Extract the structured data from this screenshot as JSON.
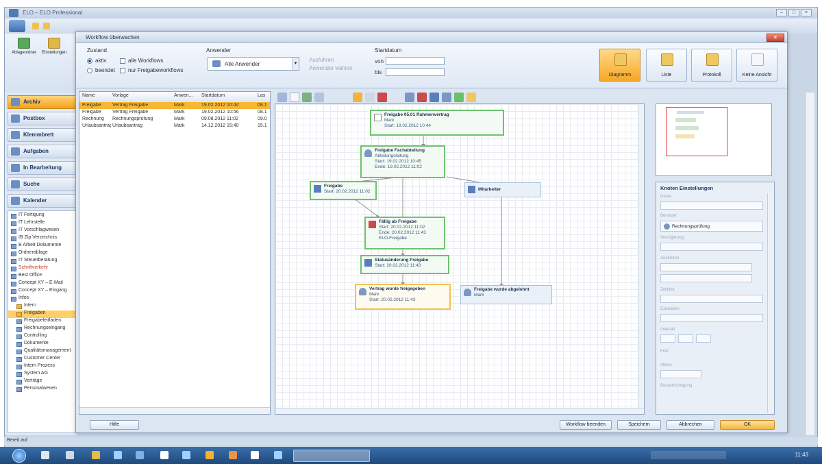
{
  "app": {
    "title": "ELO – ELO Professional",
    "minimize": "–",
    "maximize": "□",
    "close": "×"
  },
  "ribbon": {
    "button1": "Ablageordner",
    "button2": "Einstellungen"
  },
  "sidebar": {
    "items": [
      {
        "label": "Archiv",
        "active": true
      },
      {
        "label": "Postbox"
      },
      {
        "label": "Klemmbrett"
      },
      {
        "label": "Aufgaben"
      },
      {
        "label": "In Bearbeitung"
      },
      {
        "label": "Suche"
      },
      {
        "label": "Kalender"
      }
    ],
    "tree": [
      {
        "label": "IT Fertigung",
        "indent": 0
      },
      {
        "label": "IT Lehrstelle",
        "indent": 0
      },
      {
        "label": "IT Vorschlagwesen",
        "indent": 0
      },
      {
        "label": "IB Zip Verzeichnis",
        "indent": 0
      },
      {
        "label": "B Arbeit Dokumente",
        "indent": 0
      },
      {
        "label": "Ordnerablage",
        "indent": 0
      },
      {
        "label": "IT Steuerberatung",
        "indent": 0
      },
      {
        "label": "Schriftverkehr",
        "indent": 0
      },
      {
        "label": "Best Office",
        "indent": 0
      },
      {
        "label": "Concept XY – E-Mail",
        "indent": 0
      },
      {
        "label": "Concept XY – Eingang",
        "indent": 0
      },
      {
        "label": "Infos",
        "indent": 0
      },
      {
        "label": "Intern",
        "indent": 1
      },
      {
        "label": "Freigaben",
        "indent": 1,
        "selected": true
      },
      {
        "label": "Freigabeleitfaden",
        "indent": 1
      },
      {
        "label": "Rechnungseingang",
        "indent": 1
      },
      {
        "label": "Controlling",
        "indent": 1
      },
      {
        "label": "Dokumente",
        "indent": 1
      },
      {
        "label": "Qualitätsmanagement",
        "indent": 1
      },
      {
        "label": "Customer Center",
        "indent": 1
      },
      {
        "label": "Intern Prozess",
        "indent": 1
      },
      {
        "label": "System AG",
        "indent": 1
      },
      {
        "label": "Verträge",
        "indent": 1
      },
      {
        "label": "Personalwesen",
        "indent": 1
      }
    ]
  },
  "dialog": {
    "title": "Workflow überwachen",
    "close": "×",
    "filter": {
      "section1": "Zustand",
      "radio1": "aktiv",
      "radio2": "beendet",
      "check1": "alle Workflows",
      "check2": "nur Freigabeworkflows",
      "section2": "Anwender",
      "user_value": "Alle Anwender",
      "link1": "Ausführen",
      "link2": "Anwender wählen",
      "section3": "Startdatum",
      "from_label": "von",
      "to_label": "bis"
    },
    "views": [
      {
        "label": "Diagramm",
        "active": true
      },
      {
        "label": "Liste"
      },
      {
        "label": "Protokoll"
      },
      {
        "label": "Keine Ansicht"
      }
    ],
    "list": {
      "columns": [
        "Name",
        "Vorlage",
        "Anwen...",
        "Startdatum",
        "Las"
      ],
      "rows": [
        {
          "name": "Freigabe",
          "template": "Vertrag Freigabe",
          "user": "Mark",
          "date": "19.02.2012 10:44",
          "last": "08.1",
          "selected": true
        },
        {
          "name": "Freigabe",
          "template": "Vertrag Freigabe",
          "user": "Mark",
          "date": "19.02.2012 10:56",
          "last": "08.1"
        },
        {
          "name": "Rechnung",
          "template": "Rechnungsprüfung",
          "user": "Mark",
          "date": "09.08.2012 11:02",
          "last": "09.0"
        },
        {
          "name": "Urlaubsantrag",
          "template": "Urlaubsantrag",
          "user": "Mark",
          "date": "14.12.2012 15:40",
          "last": "15.1"
        }
      ]
    },
    "diagram": {
      "nodes": [
        {
          "title": "Freigabe 05.01 Rahmenvertrag",
          "lines": [
            "Mark",
            "Start: 19.02.2012 10:44"
          ]
        },
        {
          "title": "Freigabe Fachabteilung",
          "lines": [
            "Abteilungsleitung",
            "Start: 19.02.2012 10:45",
            "Ende: 19.02.2012 11:02"
          ]
        },
        {
          "title": "Freigabe",
          "lines": [
            "Start: 20.02.2012 11:02"
          ]
        },
        {
          "title": "Mitarbeiter",
          "lines": []
        },
        {
          "title": "Fällig ab Freigabe",
          "lines": [
            "Start: 20.02.2012 11:02",
            "Ende: 20.02.2012 11:43",
            "ELO-Freigabe"
          ]
        },
        {
          "title": "Statusänderung Freigabe",
          "lines": [
            "Start: 20.02.2012 11:43"
          ]
        },
        {
          "title": "Vertrag wurde freigegeben",
          "lines": [
            "Mark",
            "Start: 20.02.2012 11:43"
          ]
        },
        {
          "title": "Freigabe wurde abgelehnt",
          "lines": [
            "Mark"
          ]
        }
      ]
    },
    "props": {
      "title": "Knoten Einstellungen",
      "fields": [
        "Name",
        "Benutzer",
        "Verzögerung",
        "Ausführen",
        "Zeitlimit",
        "Eskalation",
        "Intervall",
        "Frist",
        "Aktion",
        "Benachrichtigung"
      ],
      "user_value": "Rechnungsprüfung"
    },
    "buttons": {
      "help": "Hilfe",
      "workflow": "Workflow beenden",
      "save": "Speichern",
      "cancel": "Abbrechen",
      "ok": "OK"
    }
  },
  "statusbar": {
    "text": "Bereit auf"
  },
  "taskbar": {
    "clock": "11:43"
  }
}
